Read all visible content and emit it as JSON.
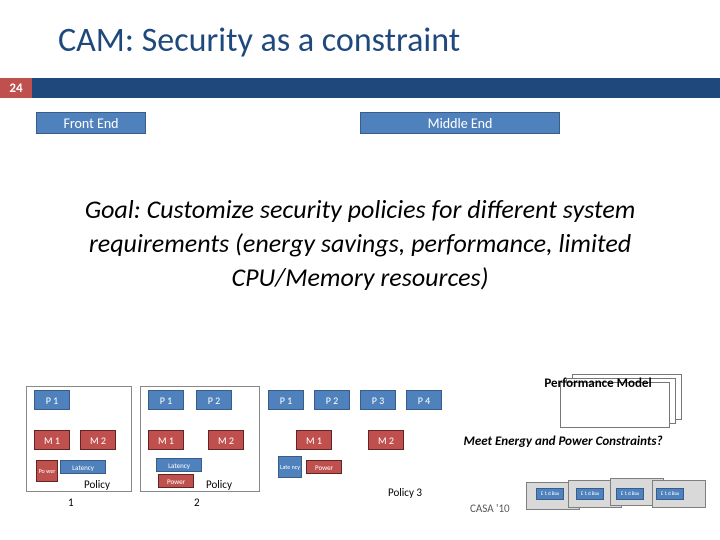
{
  "title": "CAM: Security as a constraint",
  "page_number": "24",
  "sections": {
    "front_end": "Front End",
    "middle_end": "Middle End"
  },
  "goal": "Goal: Customize security policies for different system requirements (energy savings, performance, limited CPU/Memory resources)",
  "labels": {
    "P1": "P 1",
    "P2": "P 2",
    "P3": "P 3",
    "P4": "P 4",
    "M1": "M 1",
    "M2": "M 2",
    "latency": "Latency",
    "power": "Power",
    "late_ncy": "Late ncy",
    "po_wer": "Po wer",
    "policy": "Policy",
    "policy3": "Policy 3",
    "n1": "1",
    "n2": "2"
  },
  "perf_model": "Performance Model",
  "meet_energy": "Meet Energy and Power Constraints?",
  "footer": "CASA '10",
  "tiny": "E 1 d Box"
}
